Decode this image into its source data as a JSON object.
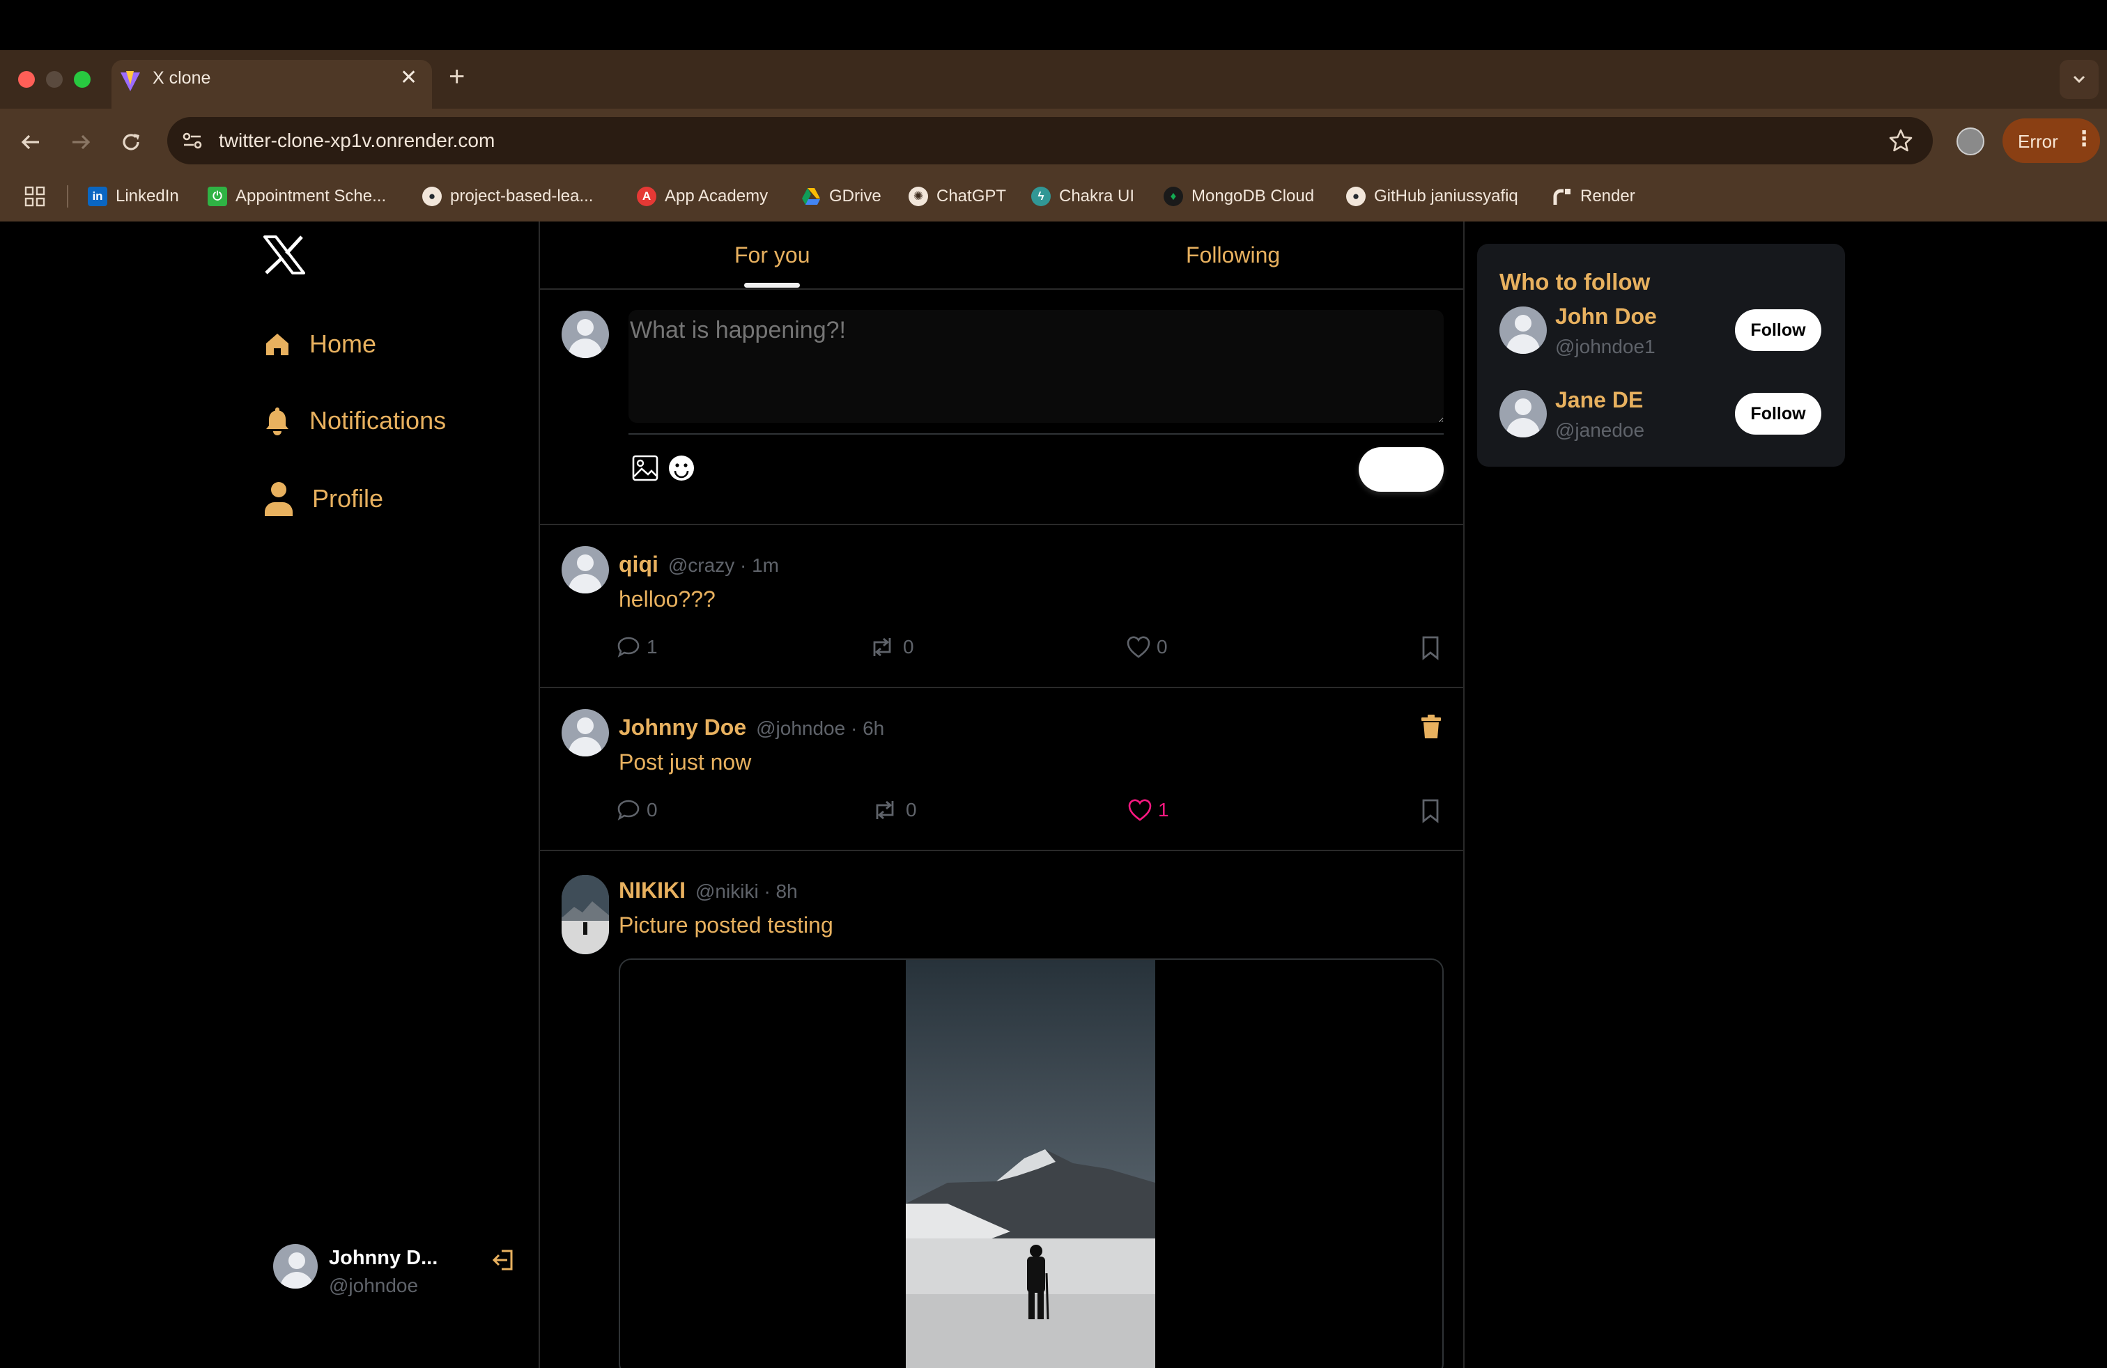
{
  "browser": {
    "tab_title": "X clone",
    "url": "twitter-clone-xp1v.onrender.com",
    "error_label": "Error",
    "bookmarks": [
      {
        "label": "LinkedIn",
        "icon": "linkedin-icon"
      },
      {
        "label": "Appointment Sche...",
        "icon": "appointment-icon"
      },
      {
        "label": "project-based-lea...",
        "icon": "github-icon"
      },
      {
        "label": "App Academy",
        "icon": "app-academy-icon"
      },
      {
        "label": "GDrive",
        "icon": "gdrive-icon"
      },
      {
        "label": "ChatGPT",
        "icon": "chatgpt-icon"
      },
      {
        "label": "Chakra UI",
        "icon": "chakra-icon"
      },
      {
        "label": "MongoDB Cloud",
        "icon": "mongodb-icon"
      },
      {
        "label": "GitHub janiussyafiq",
        "icon": "github-icon"
      },
      {
        "label": "Render",
        "icon": "render-icon"
      }
    ]
  },
  "sidebar": {
    "logo_icon": "x-logo-icon",
    "items": [
      {
        "label": "Home",
        "icon": "home-icon"
      },
      {
        "label": "Notifications",
        "icon": "bell-icon"
      },
      {
        "label": "Profile",
        "icon": "user-icon"
      }
    ],
    "user": {
      "name": "Johnny D...",
      "handle": "@johndoe"
    }
  },
  "feed": {
    "tabs": [
      {
        "label": "For you",
        "active": true
      },
      {
        "label": "Following",
        "active": false
      }
    ],
    "compose": {
      "placeholder": "What is happening?!"
    },
    "posts": [
      {
        "name": "qiqi",
        "handle": "@crazy · 1m",
        "text": "helloo???",
        "comments": "1",
        "reposts": "0",
        "likes": "0",
        "liked": false
      },
      {
        "name": "Johnny Doe",
        "handle": "@johndoe · 6h",
        "text": "Post just now",
        "comments": "0",
        "reposts": "0",
        "likes": "1",
        "liked": true
      },
      {
        "name": "NIKIKI",
        "handle": "@nikiki · 8h",
        "text": "Picture posted testing"
      }
    ]
  },
  "who_to_follow": {
    "title": "Who to follow",
    "follow_label": "Follow",
    "users": [
      {
        "name": "John Doe",
        "handle": "@johndoe1"
      },
      {
        "name": "Jane DE",
        "handle": "@janedoe"
      }
    ]
  },
  "colors": {
    "accent": "#e8b15f",
    "like": "#f91880",
    "muted": "#5f636a",
    "chrome": "#4e3826"
  }
}
